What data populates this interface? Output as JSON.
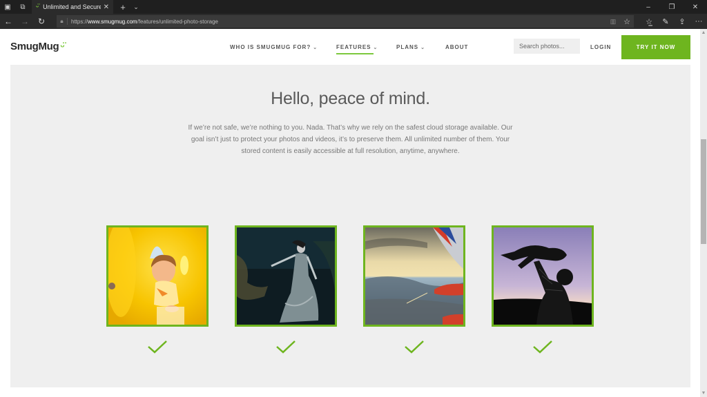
{
  "browser": {
    "tab": {
      "title": "Unlimited and Secure P",
      "favicon": "smugmug-smile-icon"
    },
    "url": {
      "prefix": "https://",
      "domain": "www.smugmug.com",
      "path": "/features/unlimited-photo-storage"
    },
    "icons": {
      "tab_manager": "tab-manager-icon",
      "set_aside": "set-aside-tabs-icon",
      "new_tab": "+",
      "tab_list": "chevron-down-icon",
      "back": "←",
      "forward": "→",
      "refresh": "↻",
      "lock": "lock-icon",
      "reading_view": "reading-view-icon",
      "favorite": "☆",
      "favorites_hub": "favorites-list-icon",
      "notes": "pen-icon",
      "share": "share-icon",
      "more": "···",
      "minimize": "–",
      "restore": "❐",
      "close": "✕"
    }
  },
  "site": {
    "logo": "SmugMug",
    "nav": [
      {
        "label": "WHO IS SMUGMUG FOR?",
        "has_dropdown": true,
        "active": false
      },
      {
        "label": "FEATURES",
        "has_dropdown": true,
        "active": true
      },
      {
        "label": "PLANS",
        "has_dropdown": true,
        "active": false
      },
      {
        "label": "ABOUT",
        "has_dropdown": false,
        "active": false
      }
    ],
    "search_placeholder": "Search photos...",
    "login": "LOGIN",
    "cta": "TRY IT NOW",
    "accent_color": "#6eb51f"
  },
  "main": {
    "headline": "Hello, peace of mind.",
    "body": "If we’re not safe, we’re nothing to you. Nada. That’s why we rely on the safest cloud storage available. Our goal isn’t just to protect your photos and videos, it’s to preserve them. All unlimited number of them. Your stored content is easily accessible at full resolution, anytime, anywhere.",
    "photos": [
      {
        "subject": "Smiling toddler in a yellow play tunnel",
        "checked": true
      },
      {
        "subject": "Woman in flowing gray gown underwater",
        "checked": true
      },
      {
        "subject": "Airplane wing over mountains at sunset",
        "checked": true
      },
      {
        "subject": "Silhouette of parent lifting child at dusk",
        "checked": true
      }
    ]
  }
}
